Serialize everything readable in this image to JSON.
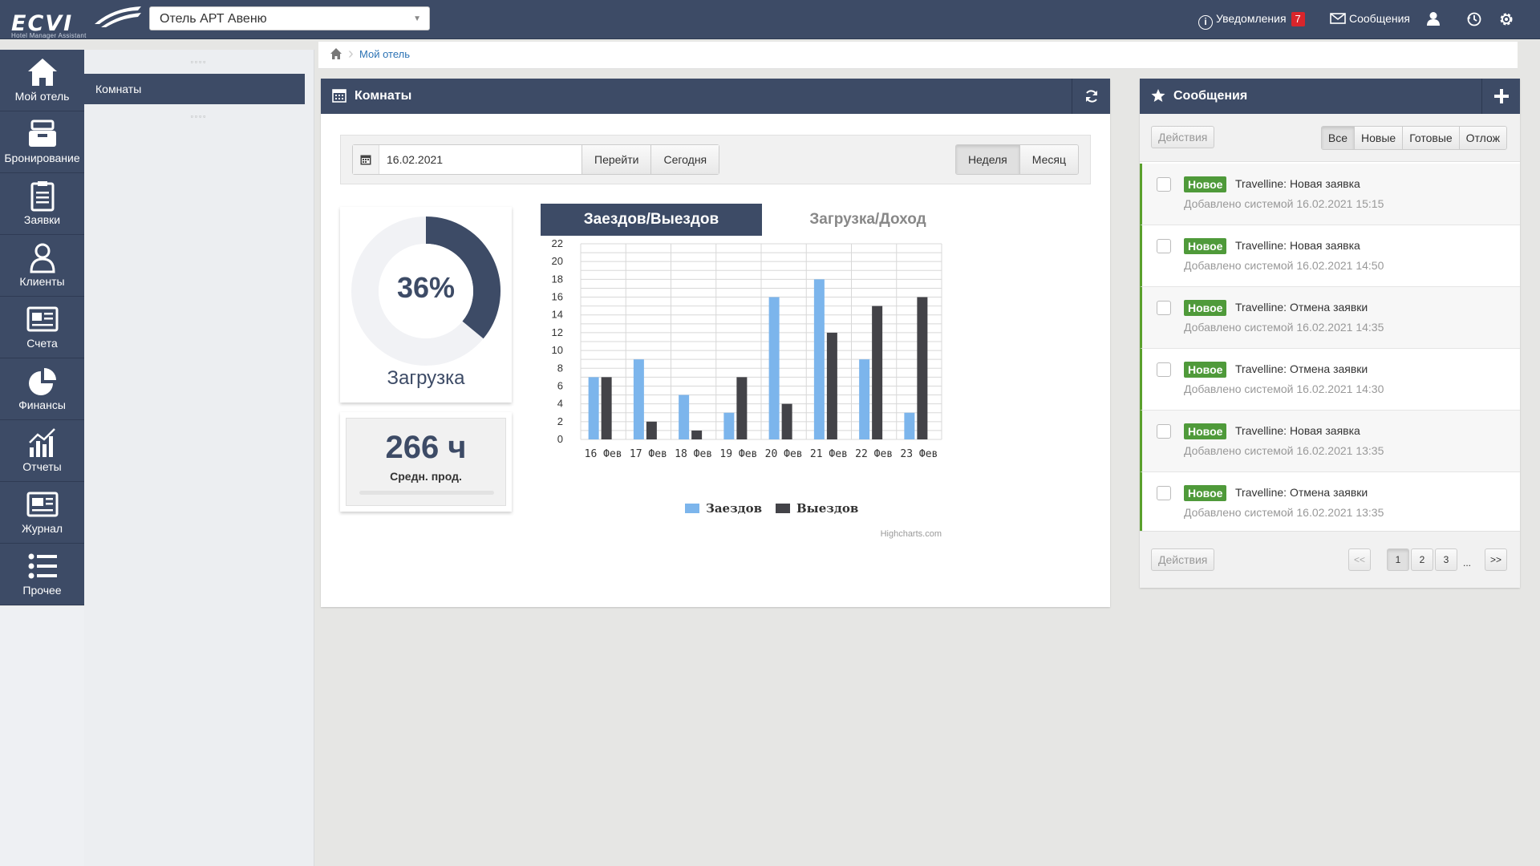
{
  "header": {
    "logo_text": "ECVI",
    "logo_subtitle": "Hotel Manager Assistant",
    "hotel_select": "Отель АРТ Авеню",
    "notifications_label": "Уведомления",
    "notifications_count": "7",
    "messages_label": "Сообщения"
  },
  "nav": {
    "items": [
      {
        "label": "Мой отель",
        "icon": "home-icon"
      },
      {
        "label": "Бронирование",
        "icon": "inbox-icon"
      },
      {
        "label": "Заявки",
        "icon": "clipboard-icon"
      },
      {
        "label": "Клиенты",
        "icon": "user-icon"
      },
      {
        "label": "Счета",
        "icon": "newspaper-icon"
      },
      {
        "label": "Финансы",
        "icon": "pie-chart-icon"
      },
      {
        "label": "Отчеты",
        "icon": "bar-chart-icon"
      },
      {
        "label": "Журнал",
        "icon": "journal-icon"
      },
      {
        "label": "Прочее",
        "icon": "list-icon"
      }
    ]
  },
  "subnav": {
    "items": [
      "Комнаты"
    ]
  },
  "breadcrumb": {
    "link": "Мой отель"
  },
  "rooms": {
    "title": "Комнаты",
    "date": "16.02.2021",
    "go_label": "Перейти",
    "today_label": "Сегодня",
    "week_label": "Неделя",
    "month_label": "Месяц",
    "load_percent": "36%",
    "load_value": 0.36,
    "load_label": "Загрузка",
    "avg_value": "266 ч",
    "avg_label": "Средн. прод.",
    "tab_active": "Заездов/Выездов",
    "tab_inactive": "Загрузка/Доход"
  },
  "chart_data": {
    "type": "bar",
    "categories": [
      "16 Фев",
      "17 Фев",
      "18 Фев",
      "19 Фев",
      "20 Фев",
      "21 Фев",
      "22 Фев",
      "23 Фев"
    ],
    "series": [
      {
        "name": "Заездов",
        "values": [
          7,
          9,
          5,
          3,
          16,
          18,
          9,
          3
        ],
        "color": "#7cb5ec"
      },
      {
        "name": "Выездов",
        "values": [
          7,
          2,
          1,
          7,
          4,
          12,
          15,
          16
        ],
        "color": "#434348"
      }
    ],
    "yticks": [
      0,
      2,
      4,
      6,
      8,
      10,
      12,
      14,
      16,
      18,
      20,
      22
    ],
    "ylim": [
      0,
      22
    ],
    "grid": true,
    "legend": "bottom",
    "credit": "Highcharts.com"
  },
  "messages": {
    "title": "Сообщения",
    "actions_label": "Действия",
    "filters": [
      "Все",
      "Новые",
      "Готовые",
      "Отлож"
    ],
    "active_filter": "Все",
    "items": [
      {
        "badge": "Новое",
        "title": "Travelline: Новая заявка",
        "meta": "Добавлено системой 16.02.2021 15:15"
      },
      {
        "badge": "Новое",
        "title": "Travelline: Новая заявка",
        "meta": "Добавлено системой 16.02.2021 14:50"
      },
      {
        "badge": "Новое",
        "title": "Travelline: Отмена заявки",
        "meta": "Добавлено системой 16.02.2021 14:35"
      },
      {
        "badge": "Новое",
        "title": "Travelline: Отмена заявки",
        "meta": "Добавлено системой 16.02.2021 14:30"
      },
      {
        "badge": "Новое",
        "title": "Travelline: Новая заявка",
        "meta": "Добавлено системой 16.02.2021 13:35"
      },
      {
        "badge": "Новое",
        "title": "Travelline: Отмена заявки",
        "meta": "Добавлено системой 16.02.2021 13:35"
      }
    ],
    "pager": {
      "prev": "<<",
      "pages": [
        "1",
        "2",
        "3"
      ],
      "gap": "...",
      "next": ">>",
      "current": "1"
    }
  },
  "colors": {
    "primary": "#3d4b66",
    "badge_green": "#4f9a3a",
    "badge_red": "#d9252b",
    "link": "#2b72b4"
  }
}
